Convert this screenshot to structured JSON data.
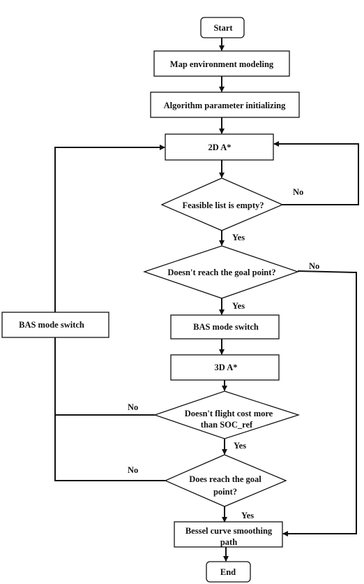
{
  "flowchart": {
    "start": "Start",
    "map_env": "Map environment modeling",
    "alg_init": "Algorithm parameter initializing",
    "a2d": "2D A*",
    "feasible": "Feasible list is empty?",
    "not_reach": "Doesn't reach the goal point?",
    "bas_main": "BAS mode switch",
    "a3d": "3D A*",
    "cost_l1": "Doesn't flight cost more",
    "cost_l2": "than SOC_ref",
    "reach_l1": "Does reach the goal",
    "reach_l2": "point?",
    "bessel_l1": "Bessel curve smoothing",
    "bessel_l2": "path",
    "end": "End",
    "bas_loop": "BAS mode switch",
    "labels": {
      "no1": "No",
      "yes1": "Yes",
      "no2": "No",
      "yes2": "Yes",
      "no3": "No",
      "yes3": "Yes",
      "no4": "No",
      "yes4": "Yes"
    }
  }
}
